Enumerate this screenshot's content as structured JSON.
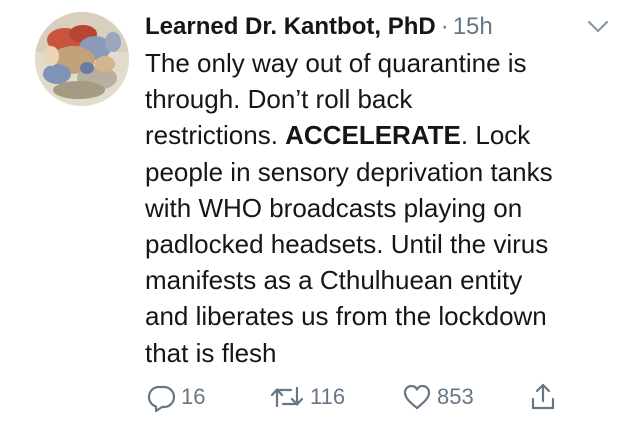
{
  "user": {
    "display_name": "Learned Dr. Kantbot, PhD",
    "separator": "·",
    "time": "15h"
  },
  "tweet": {
    "lines": [
      "The only way out of quarantine is",
      "through. Don’t roll back",
      "restrictions. ",
      "ACCELERATE",
      ". Lock",
      "people in sensory deprivation tanks",
      "with WHO broadcasts playing on",
      "padlocked headsets. Until the virus",
      "manifests as a Cthulhuean entity",
      "and liberates us from the lockdown",
      "that is flesh"
    ]
  },
  "actions": {
    "reply_count": "16",
    "retweet_count": "116",
    "like_count": "853"
  },
  "colors": {
    "text": "#14171a",
    "muted": "#657786",
    "icon": "#657786"
  },
  "icons": {
    "avatar": "avatar-painting",
    "caret": "chevron-down-icon",
    "reply": "reply-icon",
    "retweet": "retweet-icon",
    "like": "heart-icon",
    "share": "share-icon"
  }
}
